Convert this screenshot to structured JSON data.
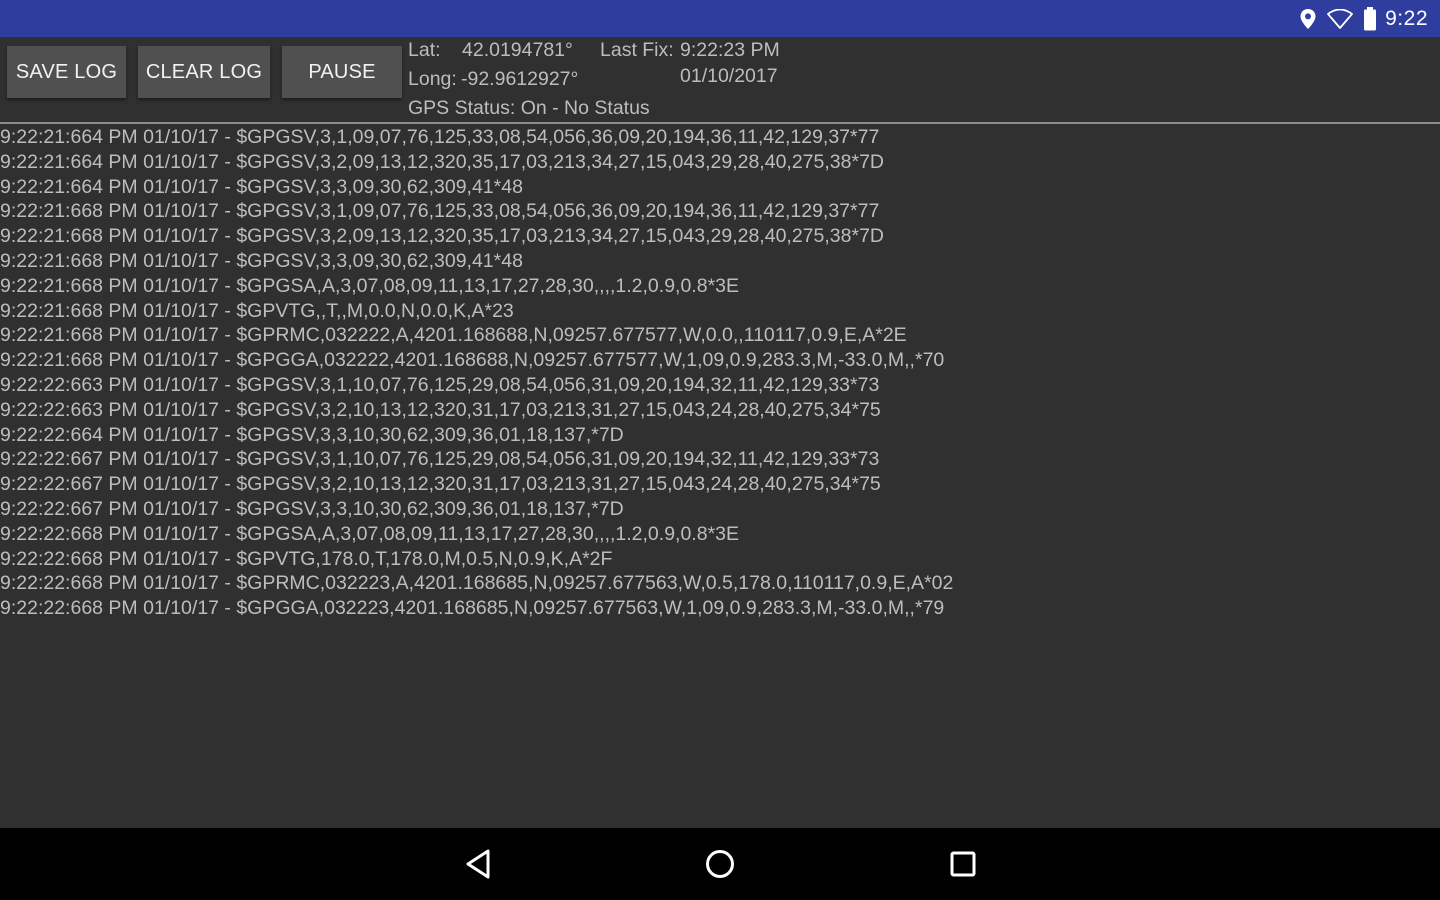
{
  "status_bar": {
    "time": "9:22",
    "icons": [
      "location-pin-icon",
      "wifi-icon",
      "battery-icon"
    ],
    "background_color": "#2f3e9e"
  },
  "toolbar": {
    "save_label": "SAVE LOG",
    "clear_label": "CLEAR LOG",
    "pause_label": "PAUSE"
  },
  "gps": {
    "lat_label": "Lat:",
    "lat_value": "42.0194781°",
    "last_fix_label": "Last Fix:",
    "last_fix_time": "9:22:23 PM",
    "last_fix_date": "01/10/2017",
    "long_label": "Long:",
    "long_value": "-92.9612927°",
    "status_text": "GPS Status: On - No Status"
  },
  "log": [
    "9:22:21:664 PM 01/10/17 - $GPGSV,3,1,09,07,76,125,33,08,54,056,36,09,20,194,36,11,42,129,37*77",
    "9:22:21:664 PM 01/10/17 - $GPGSV,3,2,09,13,12,320,35,17,03,213,34,27,15,043,29,28,40,275,38*7D",
    "9:22:21:664 PM 01/10/17 - $GPGSV,3,3,09,30,62,309,41*48",
    "9:22:21:668 PM 01/10/17 - $GPGSV,3,1,09,07,76,125,33,08,54,056,36,09,20,194,36,11,42,129,37*77",
    "9:22:21:668 PM 01/10/17 - $GPGSV,3,2,09,13,12,320,35,17,03,213,34,27,15,043,29,28,40,275,38*7D",
    "9:22:21:668 PM 01/10/17 - $GPGSV,3,3,09,30,62,309,41*48",
    "9:22:21:668 PM 01/10/17 - $GPGSA,A,3,07,08,09,11,13,17,27,28,30,,,,1.2,0.9,0.8*3E",
    "9:22:21:668 PM 01/10/17 - $GPVTG,,T,,M,0.0,N,0.0,K,A*23",
    "9:22:21:668 PM 01/10/17 - $GPRMC,032222,A,4201.168688,N,09257.677577,W,0.0,,110117,0.9,E,A*2E",
    "9:22:21:668 PM 01/10/17 - $GPGGA,032222,4201.168688,N,09257.677577,W,1,09,0.9,283.3,M,-33.0,M,,*70",
    "9:22:22:663 PM 01/10/17 - $GPGSV,3,1,10,07,76,125,29,08,54,056,31,09,20,194,32,11,42,129,33*73",
    "9:22:22:663 PM 01/10/17 - $GPGSV,3,2,10,13,12,320,31,17,03,213,31,27,15,043,24,28,40,275,34*75",
    "9:22:22:664 PM 01/10/17 - $GPGSV,3,3,10,30,62,309,36,01,18,137,*7D",
    "9:22:22:667 PM 01/10/17 - $GPGSV,3,1,10,07,76,125,29,08,54,056,31,09,20,194,32,11,42,129,33*73",
    "9:22:22:667 PM 01/10/17 - $GPGSV,3,2,10,13,12,320,31,17,03,213,31,27,15,043,24,28,40,275,34*75",
    "9:22:22:667 PM 01/10/17 - $GPGSV,3,3,10,30,62,309,36,01,18,137,*7D",
    "9:22:22:668 PM 01/10/17 - $GPGSA,A,3,07,08,09,11,13,17,27,28,30,,,,1.2,0.9,0.8*3E",
    "9:22:22:668 PM 01/10/17 - $GPVTG,178.0,T,178.0,M,0.5,N,0.9,K,A*2F",
    "9:22:22:668 PM 01/10/17 - $GPRMC,032223,A,4201.168685,N,09257.677563,W,0.5,178.0,110117,0.9,E,A*02",
    "9:22:22:668 PM 01/10/17 - $GPGGA,032223,4201.168685,N,09257.677563,W,1,09,0.9,283.3,M,-33.0,M,,*79"
  ],
  "nav_bar": {
    "buttons": [
      "back-icon",
      "home-icon",
      "recents-icon"
    ]
  }
}
